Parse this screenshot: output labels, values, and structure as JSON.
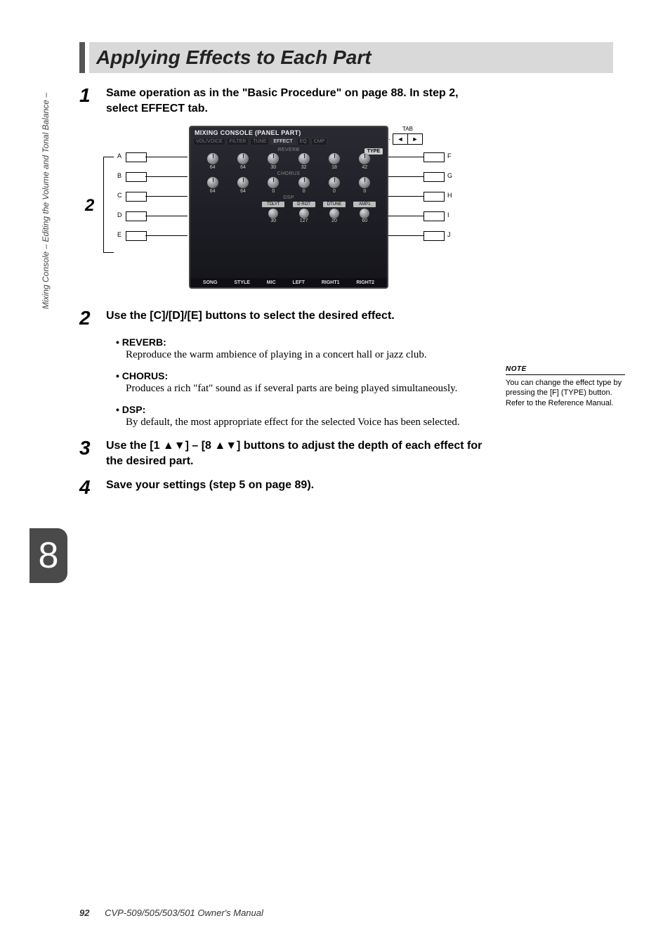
{
  "sidebar_text": "Mixing Console – Editing the Volume and Tonal Balance –",
  "chapter_number": "8",
  "heading": "Applying Effects to Each Part",
  "steps": {
    "s1": {
      "num": "1",
      "text": "Same operation as in the \"Basic Procedure\" on page 88. In step 2, select EFFECT tab."
    },
    "s2_label": "2",
    "s2": {
      "num": "2",
      "text": "Use the [C]/[D]/[E] buttons to select the desired effect."
    },
    "s3": {
      "num": "3",
      "text": "Use the [1 ▲▼] – [8 ▲▼] buttons to adjust the depth of each effect for the desired part."
    },
    "s4": {
      "num": "4",
      "text": "Save your settings (step 5 on page 89)."
    }
  },
  "effects": {
    "reverb": {
      "head": "• REVERB:",
      "body": "Reproduce the warm ambience of playing in a concert hall or jazz club."
    },
    "chorus": {
      "head": "• CHORUS:",
      "body": "Produces a rich \"fat\" sound as if several parts are being played simultaneously."
    },
    "dsp": {
      "head": "• DSP:",
      "body": "By default, the most appropriate effect for the selected Voice has been selected."
    }
  },
  "note": {
    "title": "NOTE",
    "text": "You can change the effect type by pressing the [F] (TYPE) button. Refer to the Reference Manual."
  },
  "figure": {
    "left_keys": [
      "A",
      "B",
      "C",
      "D",
      "E"
    ],
    "right_keys": [
      "F",
      "G",
      "H",
      "I",
      "J"
    ],
    "tab_label": "TAB",
    "tab_left": "◄",
    "tab_right": "►",
    "console": {
      "title": "MIXING CONSOLE (PANEL PART)",
      "tabs": [
        "VOL/VOICE",
        "FILTER",
        "TUNE",
        "EFFECT",
        "EQ",
        "CMP"
      ],
      "active_tab": 3,
      "type_btn": "TYPE",
      "section_reverb": "REVERB",
      "section_chorus": "CHORUS",
      "section_dsp": "DSP",
      "columns": [
        "SONG",
        "STYLE",
        "MIC",
        "LEFT",
        "RIGHT1",
        "RIGHT2"
      ],
      "reverb_vals": [
        "64",
        "64",
        "30",
        "32",
        "18",
        "42"
      ],
      "chorus_vals": [
        "64",
        "64",
        "0",
        "0",
        "0",
        "0"
      ],
      "dsp_names": [
        "TDLYT",
        "D ROT",
        "DTUNE",
        "AMP1"
      ],
      "dsp_vals": [
        "30",
        "127",
        "20",
        "60"
      ]
    }
  },
  "footer": {
    "page": "92",
    "manual": "CVP-509/505/503/501 Owner's Manual"
  }
}
